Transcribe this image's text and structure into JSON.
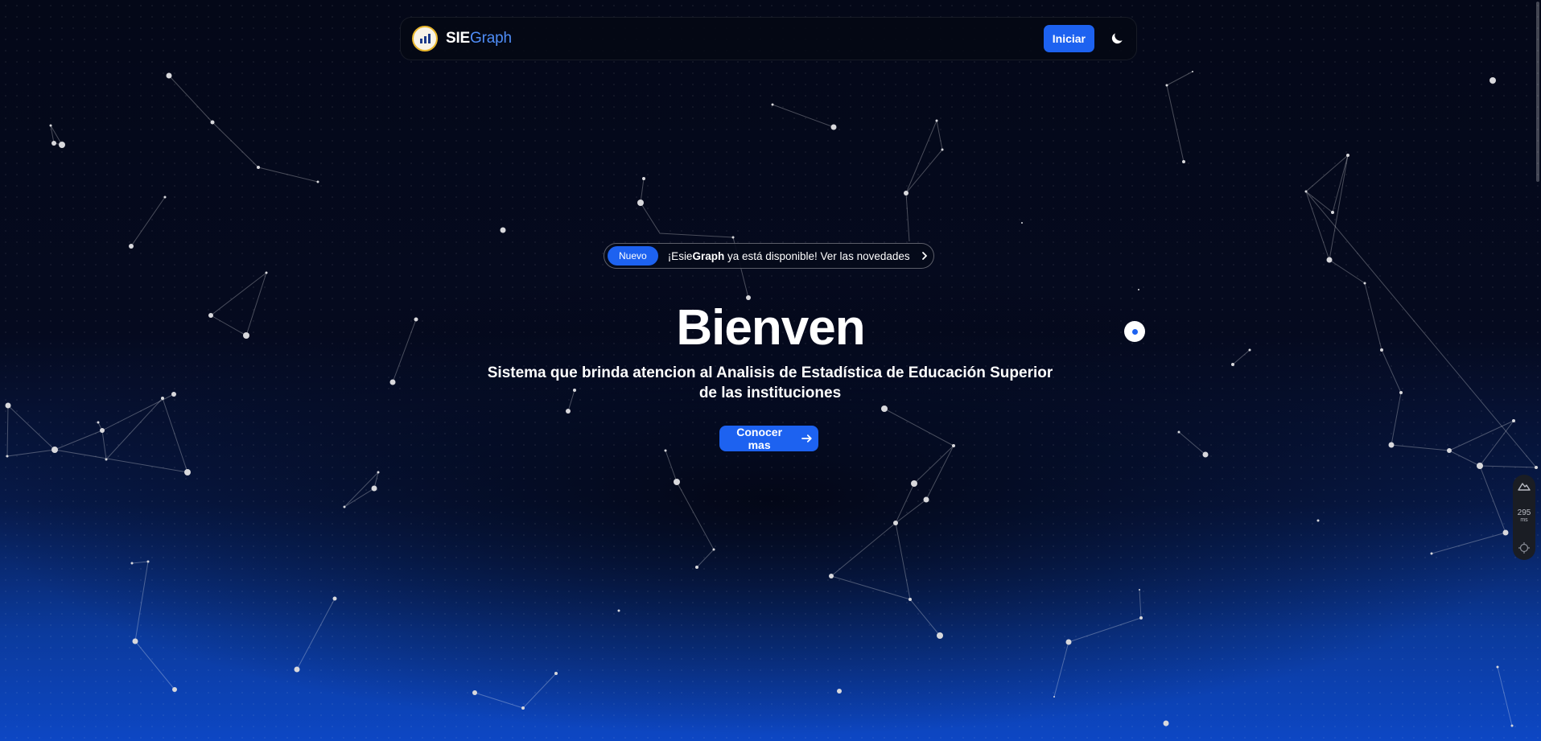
{
  "navbar": {
    "brand_primary": "SIE",
    "brand_accent": "Graph",
    "start_button_label": "Iniciar",
    "theme_toggle_icon": "moon-icon"
  },
  "announcement": {
    "badge": "Nuevo",
    "prefix": "¡Esie",
    "bold": "Graph",
    "suffix": " ya está disponible! Ver las novedades",
    "chevron_icon": "chevron-right-icon"
  },
  "hero": {
    "title": "Bienven",
    "subtitle": "Sistema que brinda atencion al Analisis de Estadística de Educación Superior de las instituciones",
    "cta_label": "Conocer mas",
    "cta_icon": "arrow-right-icon"
  },
  "devtool": {
    "latency_value": "295",
    "latency_unit": "ms"
  },
  "colors": {
    "accent": "#1d62f0",
    "brand_accent": "#4f8df7",
    "background_top": "#040818",
    "background_bottom": "#0d47c4"
  }
}
